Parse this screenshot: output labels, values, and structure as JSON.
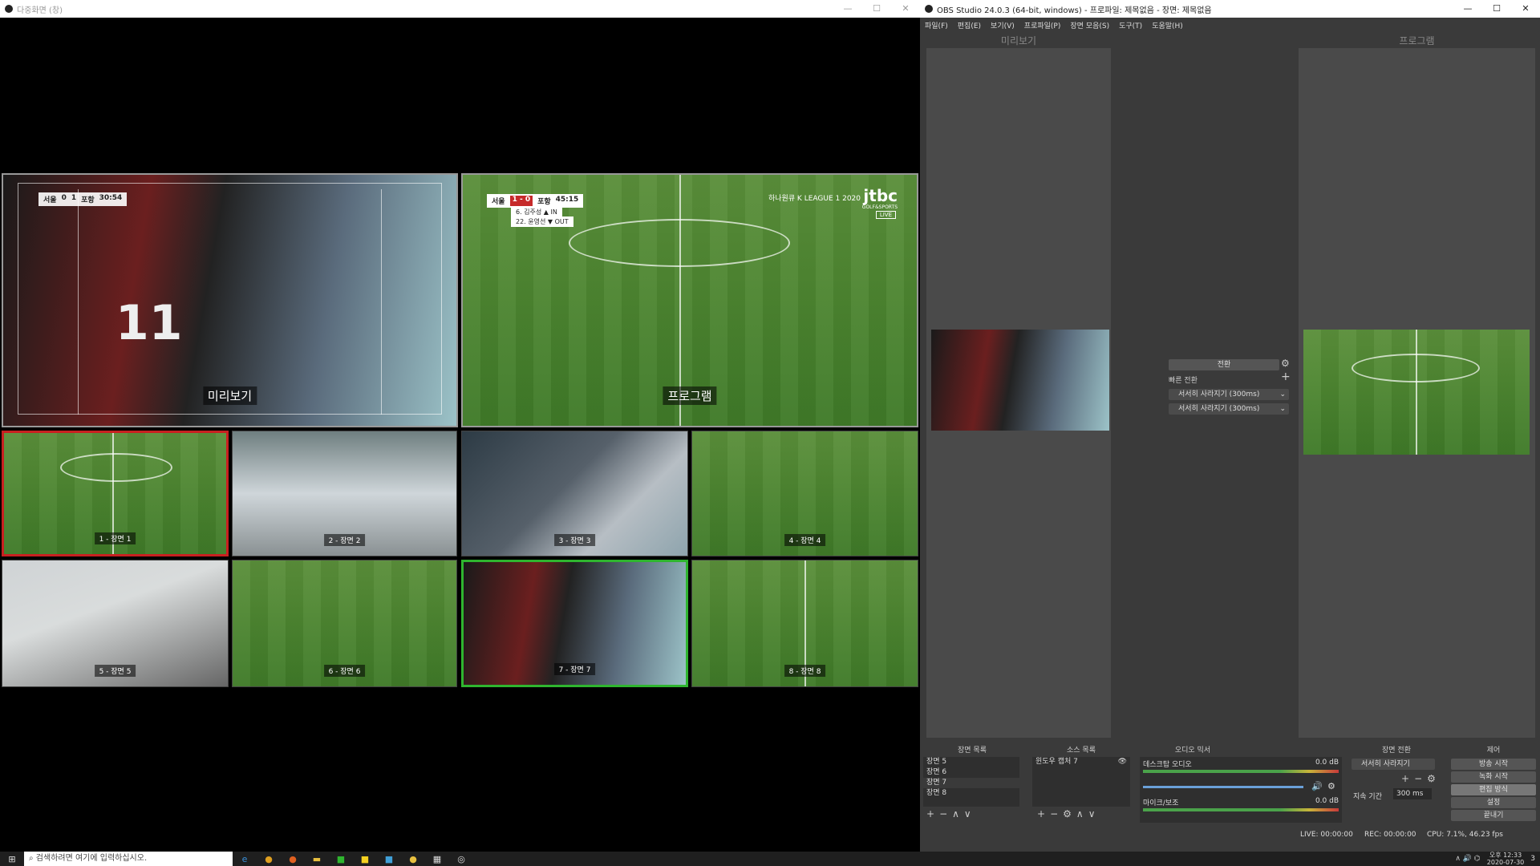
{
  "multiview": {
    "title": "다중화면 (창)",
    "preview_label": "미리보기",
    "program_label": "프로그램",
    "scenes": [
      "1 - 장면 1",
      "2 - 장면 2",
      "3 - 장면 3",
      "4 - 장면 4",
      "5 - 장면 5",
      "6 - 장면 6",
      "7 - 장면 7",
      "8 - 장면 8"
    ],
    "preview_score": {
      "home": "서울",
      "hs": "0",
      "as": "1",
      "away": "포항",
      "time": "30:54"
    },
    "program_score": {
      "home": "서울",
      "result": "1 - 0",
      "away": "포항",
      "time": "45:15",
      "line1": "6. 김주성 ▲ IN",
      "line2": "22. 윤영선 ▼ OUT"
    },
    "broadcast_text": "하나원큐 K LEAGUE 1 2020",
    "broadcaster": "jtbc",
    "sub_broadcaster": "GOLF&SPORTS",
    "live": "LIVE"
  },
  "obs": {
    "title": "OBS Studio 24.0.3 (64-bit, windows) - 프로파일: 제목없음 - 장면: 제목없음",
    "menu": [
      "파일(F)",
      "편집(E)",
      "보기(V)",
      "프로파일(P)",
      "장면 모음(S)",
      "도구(T)",
      "도움말(H)"
    ],
    "preview_header": "미리보기",
    "program_header": "프로그램",
    "transition": {
      "label": "전환",
      "quick": "빠른 전환",
      "items": [
        "서서히 사라지기 (300ms)",
        "서서히 사라지기 (300ms)"
      ]
    },
    "docks": {
      "scenes": {
        "title": "장면 목록",
        "items": [
          "장면 5",
          "장면 6",
          "장면 7",
          "장면 8"
        ]
      },
      "sources": {
        "title": "소스 목록",
        "items": [
          "윈도우 캡처 7"
        ]
      },
      "mixer": {
        "title": "오디오 믹서",
        "tracks": [
          {
            "name": "데스크탑 오디오",
            "db": "0.0 dB"
          },
          {
            "name": "마이크/보조",
            "db": "0.0 dB"
          }
        ]
      },
      "transitions": {
        "title": "장면 전환",
        "selected": "서서히 사라지기",
        "duration_label": "지속 기간",
        "duration": "300 ms"
      },
      "controls": {
        "title": "제어",
        "buttons": [
          "방송 시작",
          "녹화 시작",
          "편집 방식",
          "설정",
          "끝내기"
        ]
      }
    },
    "status": {
      "live": "LIVE: 00:00:00",
      "rec": "REC: 00:00:00",
      "cpu": "CPU: 7.1%, 46.23 fps"
    }
  },
  "taskbar": {
    "search_placeholder": "검색하려면 여기에 입력하십시오.",
    "time": "오후 12:33",
    "date": "2020-07-30",
    "notif_count": "3"
  }
}
